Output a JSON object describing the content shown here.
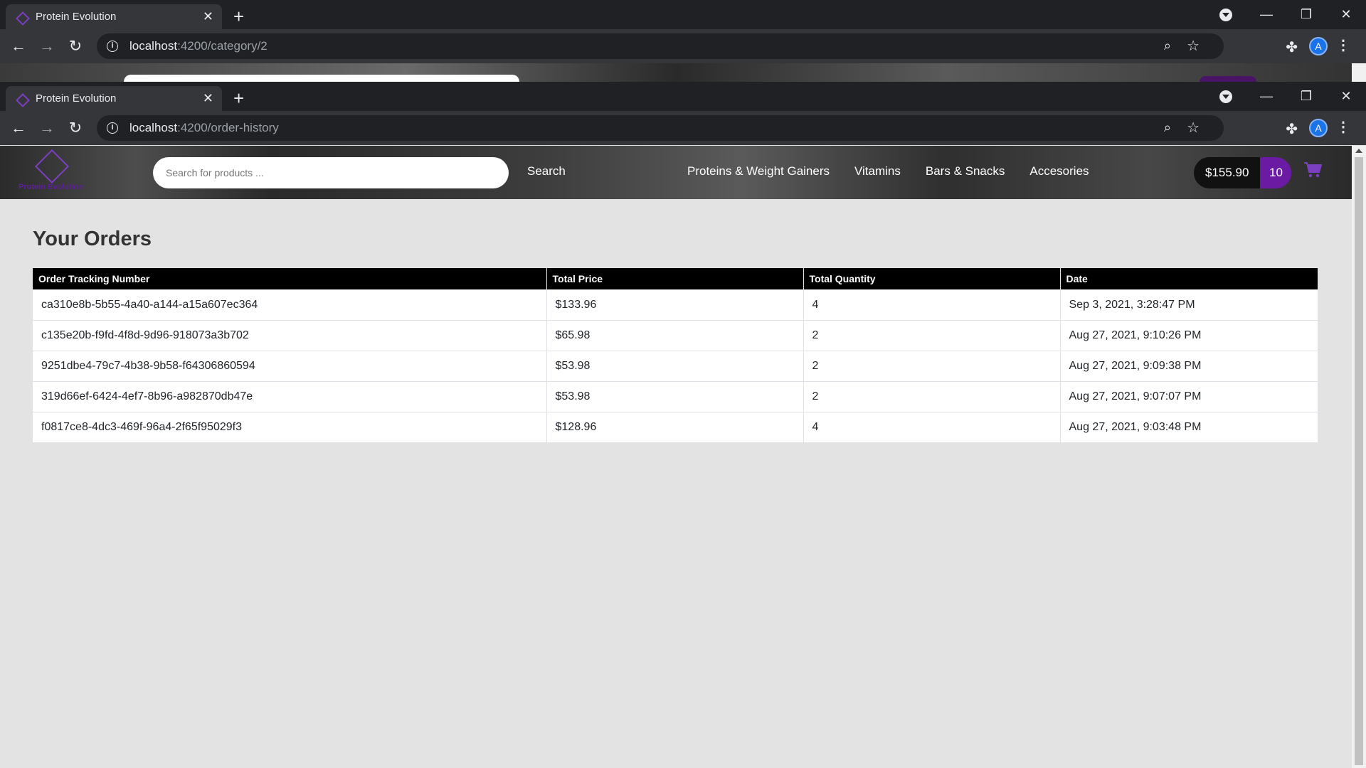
{
  "back_window": {
    "tab_title": "Protein Evolution",
    "url_host": "localhost",
    "url_path": ":4200/category/2"
  },
  "front_window": {
    "tab_title": "Protein Evolution",
    "url_host": "localhost",
    "url_path": ":4200/order-history",
    "avatar_letter": "A"
  },
  "site": {
    "logo_text": "Protein Evolution",
    "search_placeholder": "Search for products ...",
    "search_label": "Search",
    "nav": [
      {
        "label": "Proteins & Weight Gainers"
      },
      {
        "label": "Vitamins"
      },
      {
        "label": "Bars & Snacks"
      },
      {
        "label": "Accesories"
      }
    ],
    "cart_total": "$155.90",
    "cart_count": "10",
    "accent_color": "#6b1aa3"
  },
  "orders": {
    "title": "Your Orders",
    "columns": [
      "Order Tracking Number",
      "Total Price",
      "Total Quantity",
      "Date"
    ],
    "rows": [
      [
        "ca310e8b-5b55-4a40-a144-a15a607ec364",
        "$133.96",
        "4",
        "Sep 3, 2021, 3:28:47 PM"
      ],
      [
        "c135e20b-f9fd-4f8d-9d96-918073a3b702",
        "$65.98",
        "2",
        "Aug 27, 2021, 9:10:26 PM"
      ],
      [
        "9251dbe4-79c7-4b38-9b58-f64306860594",
        "$53.98",
        "2",
        "Aug 27, 2021, 9:09:38 PM"
      ],
      [
        "319d66ef-6424-4ef7-8b96-a982870db47e",
        "$53.98",
        "2",
        "Aug 27, 2021, 9:07:07 PM"
      ],
      [
        "f0817ce8-4dc3-469f-96a4-2f65f95029f3",
        "$128.96",
        "4",
        "Aug 27, 2021, 9:03:48 PM"
      ]
    ]
  }
}
